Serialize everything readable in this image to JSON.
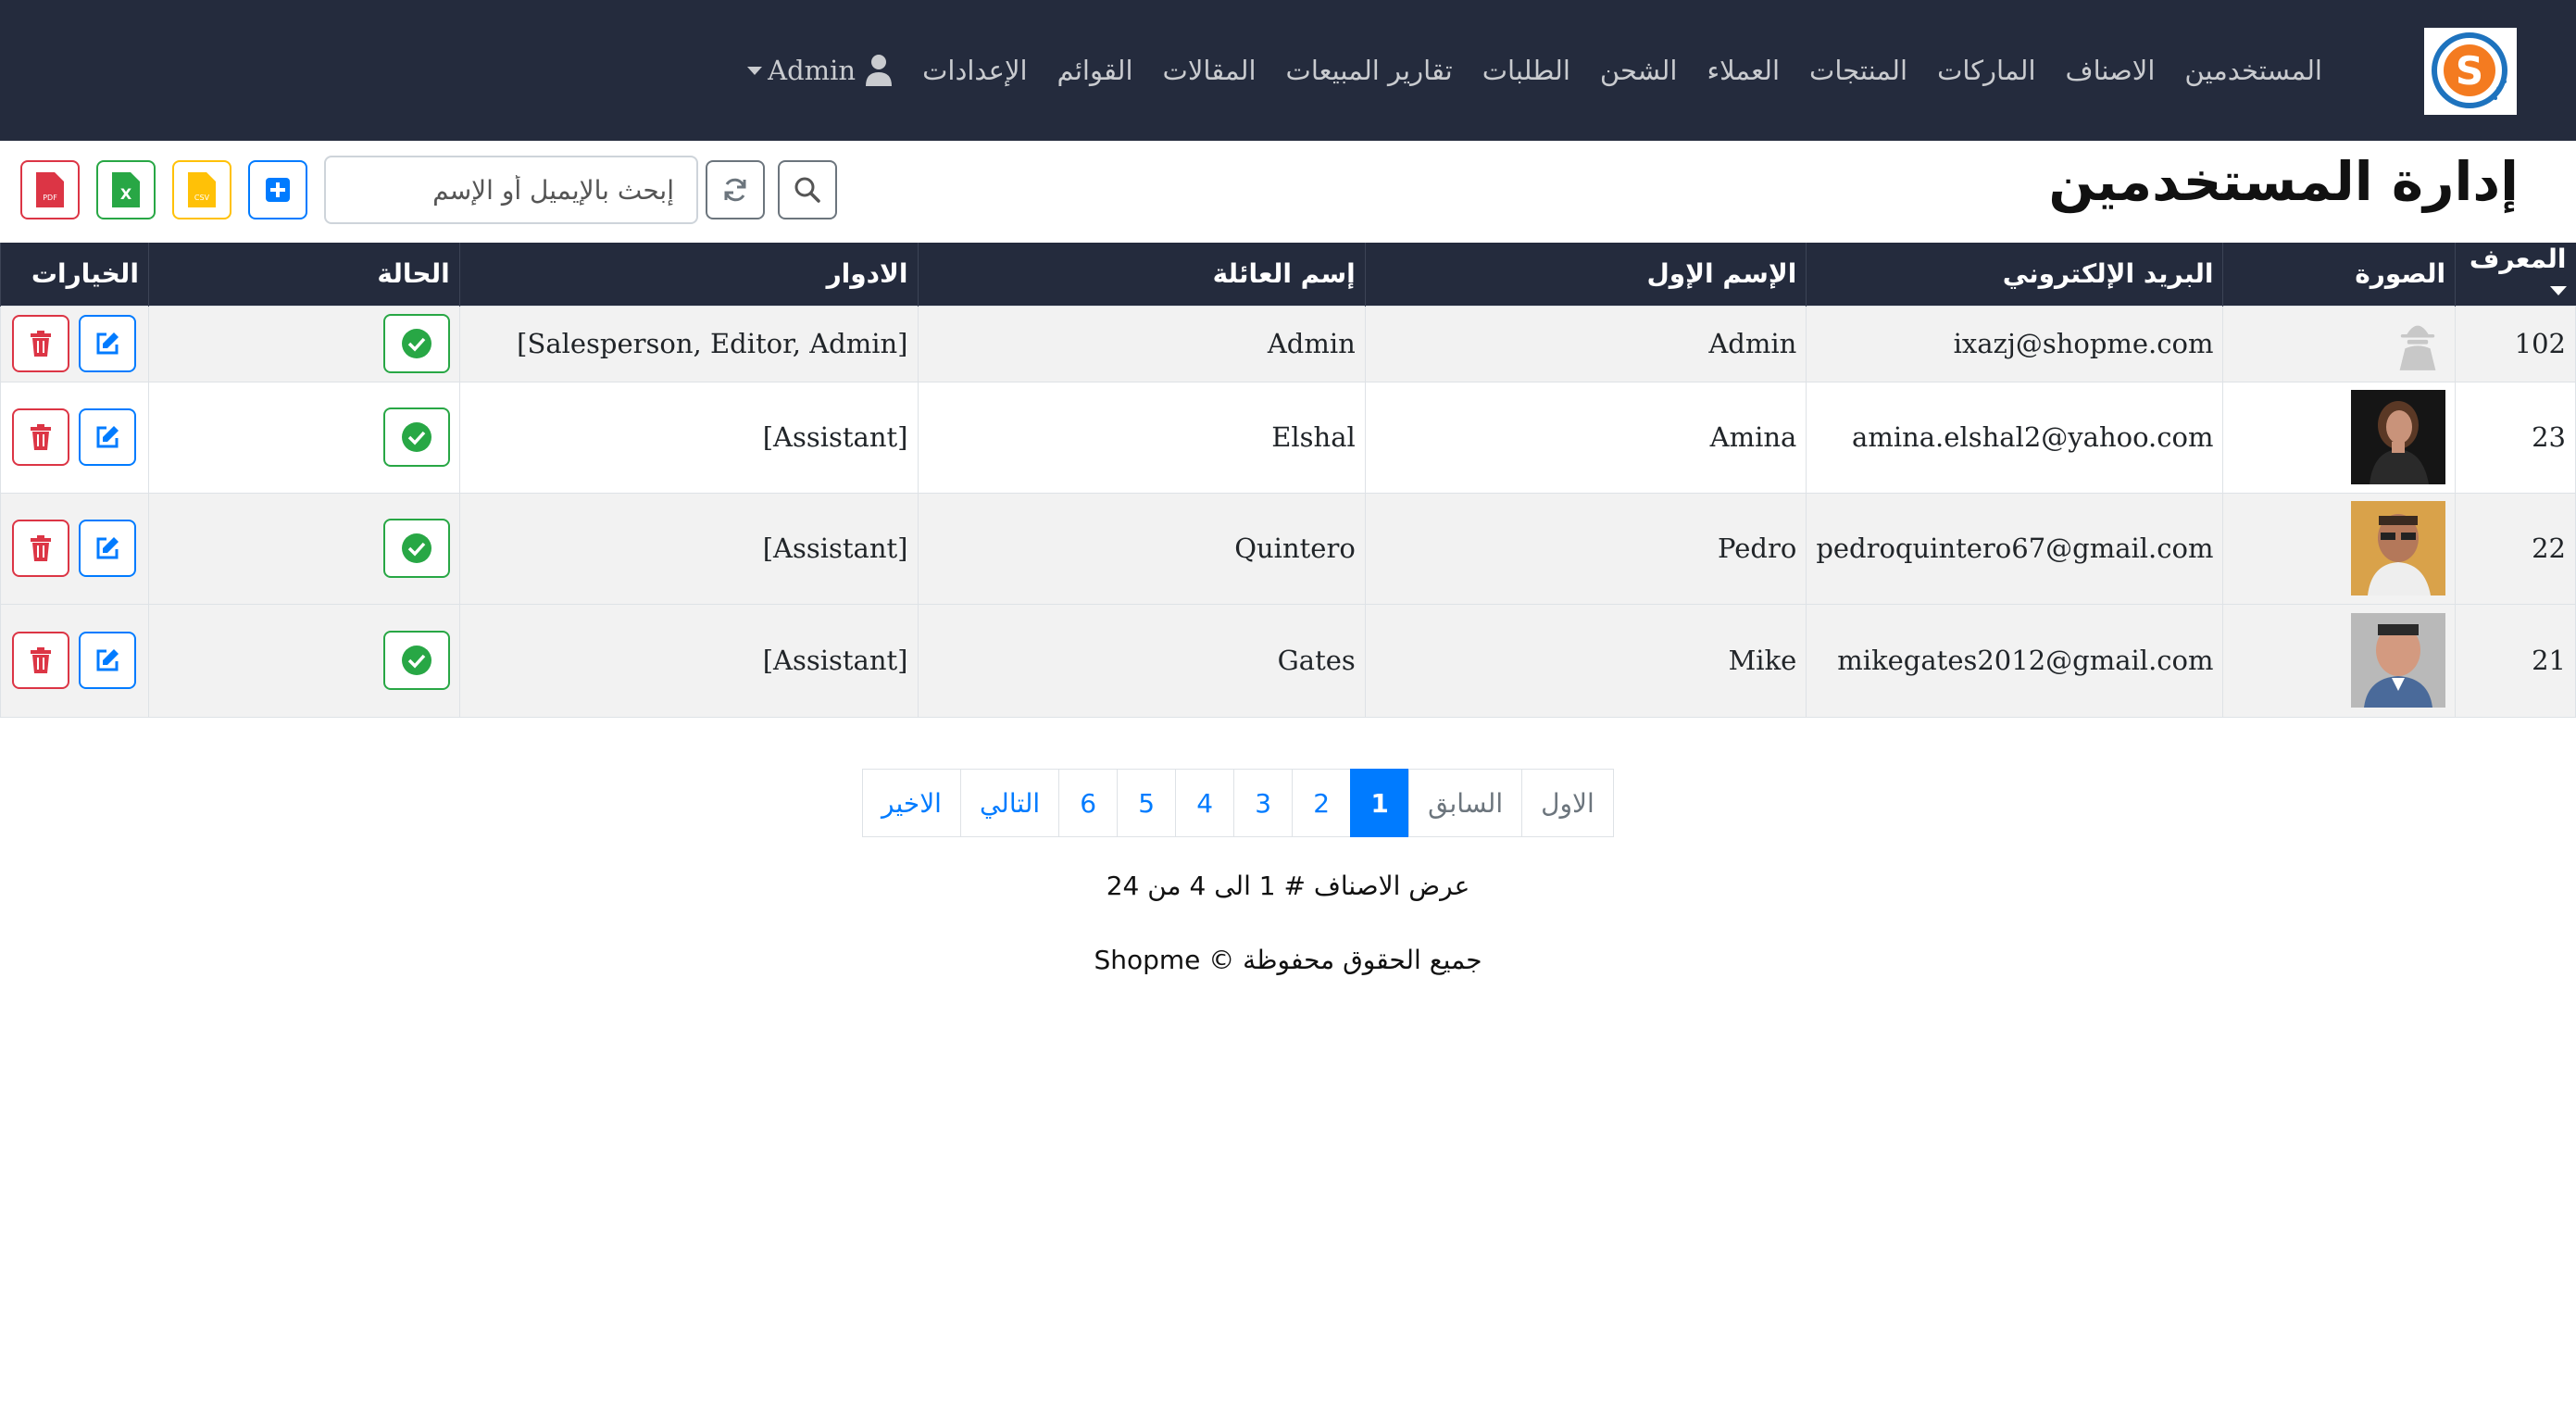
{
  "nav": {
    "logo": "S",
    "items": [
      "المستخدمين",
      "الاصناف",
      "الماركات",
      "المنتجات",
      "العملاء",
      "الشحن",
      "الطلبات",
      "تقارير المبيعات",
      "المقالات",
      "القوائم",
      "الإعدادات"
    ],
    "user_label": "Admin"
  },
  "page": {
    "title": "إدارة المستخدمين",
    "search_placeholder": "إبحث بالإيميل أو الإسم"
  },
  "toolbar_icons": {
    "pdf": "PDF",
    "excel": "X",
    "csv": "CSV",
    "add": "+"
  },
  "table": {
    "headers": {
      "id": "المعرف",
      "photo": "الصورة",
      "email": "البريد الإلكتروني",
      "first_name": "الإسم الإول",
      "last_name": "إسم العائلة",
      "roles": "الادوار",
      "status": "الحالة",
      "actions": "الخيارات"
    },
    "rows": [
      {
        "id": "102",
        "email": "ixazj@shopme.com",
        "first_name": "Admin",
        "last_name": "Admin",
        "roles": "[Salesperson, Editor, Admin]",
        "photo": "default-user-icon"
      },
      {
        "id": "23",
        "email": "amina.elshal2@yahoo.com",
        "first_name": "Amina",
        "last_name": "Elshal",
        "roles": "[Assistant]",
        "photo": "user-photo"
      },
      {
        "id": "22",
        "email": "pedroquintero67@gmail.com",
        "first_name": "Pedro",
        "last_name": "Quintero",
        "roles": "[Assistant]",
        "photo": "user-photo"
      },
      {
        "id": "21",
        "email": "mikegates2012@gmail.com",
        "first_name": "Mike",
        "last_name": "Gates",
        "roles": "[Assistant]",
        "photo": "user-photo"
      }
    ]
  },
  "pagination": {
    "first": "الاول",
    "previous": "السابق",
    "pages": [
      "1",
      "2",
      "3",
      "4",
      "5",
      "6"
    ],
    "active": "1",
    "next": "التالي",
    "last": "الاخير"
  },
  "summary": "عرض الاصناف # 1 الى 4 من 24",
  "footer": "جميع الحقوق محفوظة © Shopme",
  "colors": {
    "navbar": "#242b3d",
    "primary": "#007bff",
    "danger": "#dc3545",
    "success": "#28a745",
    "warning": "#ffc107"
  }
}
